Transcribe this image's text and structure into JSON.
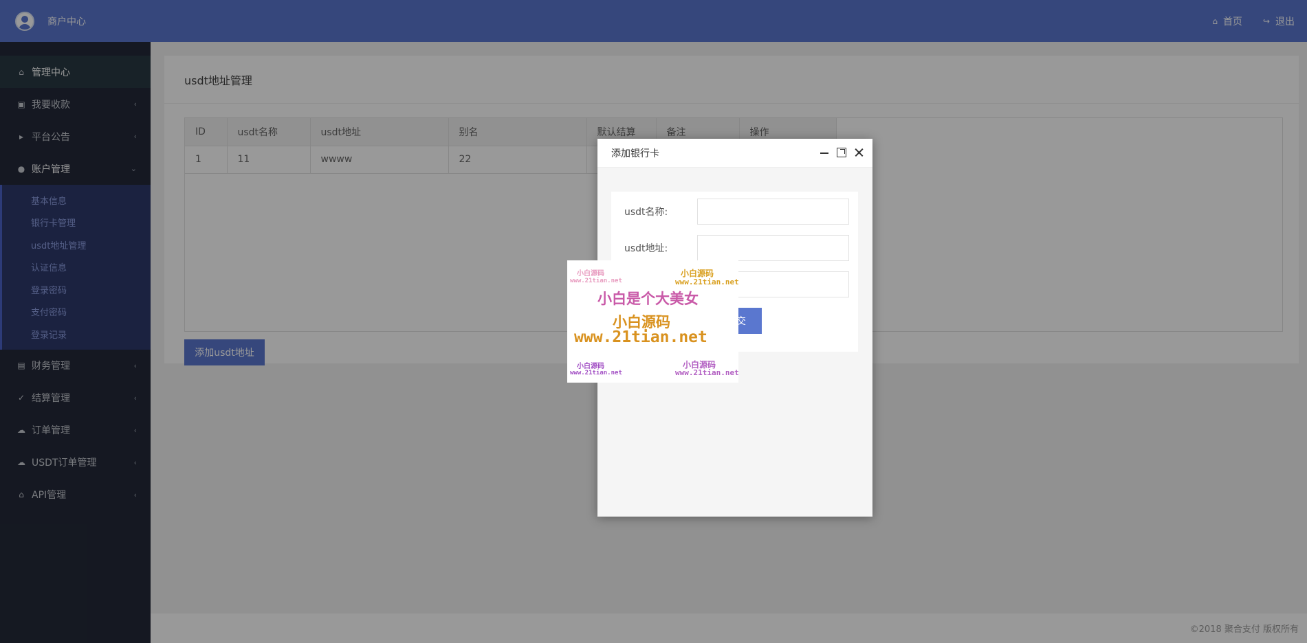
{
  "header": {
    "app_title": "商户中心",
    "home_label": "首页",
    "logout_label": "退出"
  },
  "sidebar": {
    "items": [
      {
        "label": "管理中心",
        "icon": "home-icon"
      },
      {
        "label": "我要收款",
        "icon": "lock-icon"
      },
      {
        "label": "平台公告",
        "icon": "volume-icon"
      },
      {
        "label": "账户管理",
        "icon": "user-icon"
      },
      {
        "label": "财务管理",
        "icon": "money-icon"
      },
      {
        "label": "结算管理",
        "icon": "check-icon"
      },
      {
        "label": "订单管理",
        "icon": "cloud-icon"
      },
      {
        "label": "USDT订单管理",
        "icon": "cloud-icon"
      },
      {
        "label": "API管理",
        "icon": "bank-icon"
      }
    ],
    "sub_items": [
      "基本信息",
      "银行卡管理",
      "usdt地址管理",
      "认证信息",
      "登录密码",
      "支付密码",
      "登录记录"
    ]
  },
  "main": {
    "title": "usdt地址管理",
    "table": {
      "headers": [
        "ID",
        "usdt名称",
        "usdt地址",
        "别名",
        "默认结算",
        "备注",
        "操作"
      ],
      "rows": [
        [
          "1",
          "11",
          "wwww",
          "22",
          "",
          ""
        ]
      ]
    },
    "add_button": "添加usdt地址"
  },
  "modal": {
    "title": "添加银行卡",
    "fields": [
      {
        "label": "usdt名称:"
      },
      {
        "label": "usdt地址:"
      }
    ],
    "submit_partial": "交"
  },
  "watermark": {
    "small_1": "小白源码",
    "small_1_url": "www.21tian.net",
    "small_2": "小白源码",
    "small_2_url": "www.21tian.net",
    "main": "小白是个大美女",
    "brand": "小白源码",
    "url": "www.21tian.net",
    "small_3": "小白源码",
    "small_3_url": "www.21tian.net",
    "small_4": "小白源码",
    "small_4_url": "www.21tian.net"
  },
  "footer": {
    "text": "©2018 聚合支付 版权所有"
  },
  "colors": {
    "accent": "#5a77cf",
    "sidebar": "#232939",
    "submenu": "#2d3a6c"
  }
}
